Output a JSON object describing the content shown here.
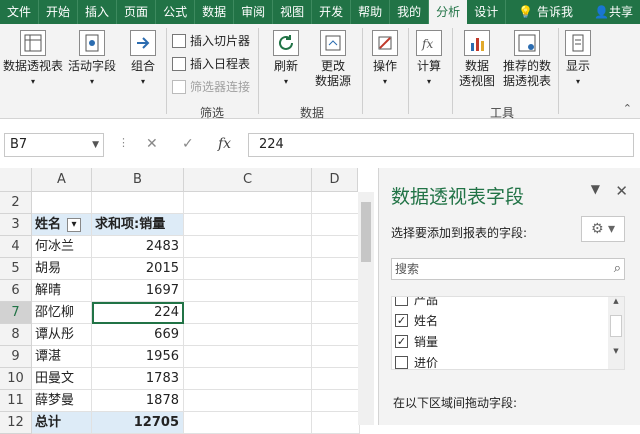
{
  "tabs": [
    "文件",
    "开始",
    "插入",
    "页面",
    "公式",
    "数据",
    "审阅",
    "视图",
    "开发",
    "帮助",
    "我的",
    "分析",
    "设计",
    "告诉我",
    "共享"
  ],
  "active_tab": "分析",
  "ribbon": {
    "pivottable": "数据透视表",
    "active_field": "活动字段",
    "group": "组合",
    "insert_slicer": "插入切片器",
    "insert_timeline": "插入日程表",
    "filter_connections": "筛选器连接",
    "filter_group": "筛选",
    "refresh": "刷新",
    "change_source_1": "更改",
    "change_source_2": "数据源",
    "data_group": "数据",
    "actions": "操作",
    "calculations": "计算",
    "pivotchart_1": "数据",
    "pivotchart_2": "透视图",
    "recommended_1": "推荐的数",
    "recommended_2": "据透视表",
    "tools_group": "工具",
    "show": "显示"
  },
  "formula_bar": {
    "name_box": "B7",
    "cancel": "✕",
    "enter": "✓",
    "fx": "fx",
    "value": "224"
  },
  "columns": [
    "A",
    "B",
    "C",
    "D"
  ],
  "rows": [
    {
      "n": "2",
      "name": "",
      "value": ""
    },
    {
      "n": "3",
      "name": "姓名",
      "value": "求和项:销量",
      "header": true
    },
    {
      "n": "4",
      "name": "何冰兰",
      "value": "2483"
    },
    {
      "n": "5",
      "name": "胡易",
      "value": "2015"
    },
    {
      "n": "6",
      "name": "解晴",
      "value": "1697"
    },
    {
      "n": "7",
      "name": "邵忆柳",
      "value": "224"
    },
    {
      "n": "8",
      "name": "谭从彤",
      "value": "669"
    },
    {
      "n": "9",
      "name": "谭湛",
      "value": "1956"
    },
    {
      "n": "10",
      "name": "田曼文",
      "value": "1783"
    },
    {
      "n": "11",
      "name": "薛梦曼",
      "value": "1878"
    },
    {
      "n": "12",
      "name": "总计",
      "value": "12705",
      "total": true
    }
  ],
  "pane": {
    "title": "数据透视表字段",
    "subtitle": "选择要添加到报表的字段:",
    "search_placeholder": "搜索",
    "fields": [
      {
        "label": "产品",
        "checked": false
      },
      {
        "label": "姓名",
        "checked": true
      },
      {
        "label": "销量",
        "checked": true
      },
      {
        "label": "进价",
        "checked": false
      }
    ],
    "drag_hint": "在以下区域间拖动字段:"
  },
  "colors": {
    "accent": "#217346",
    "ribbon_bg": "#f3f3f3",
    "selected_row": "#ddebf7"
  }
}
